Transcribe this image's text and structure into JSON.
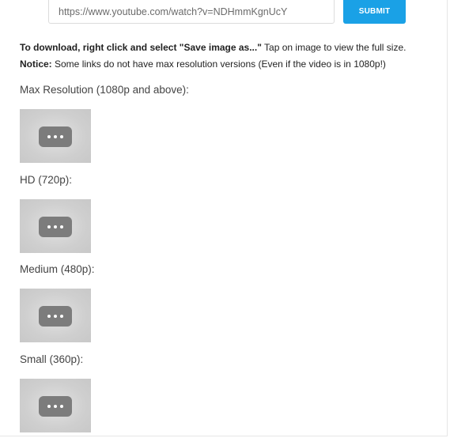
{
  "form": {
    "url_value": "https://www.youtube.com/watch?v=NDHmmKgnUcY",
    "submit_label": "SUBMIT"
  },
  "instructions": {
    "line1_bold": "To download, right click and select \"Save image as...\"",
    "line1_rest": " Tap on image to view the full size.",
    "line2_bold": "Notice:",
    "line2_rest": " Some links do not have max resolution versions (Even if the video is in 1080p!)"
  },
  "sections": [
    {
      "title": "Max Resolution (1080p and above):",
      "thumbnail_icon": "more-dots-icon"
    },
    {
      "title": "HD (720p):",
      "thumbnail_icon": "more-dots-icon"
    },
    {
      "title": "Medium (480p):",
      "thumbnail_icon": "more-dots-icon"
    },
    {
      "title": "Small (360p):",
      "thumbnail_icon": "more-dots-icon"
    }
  ],
  "colors": {
    "accent": "#1aa1e6",
    "thumbnail_bg": "#cfcfcf",
    "icon_bg": "#7c7c7c"
  }
}
